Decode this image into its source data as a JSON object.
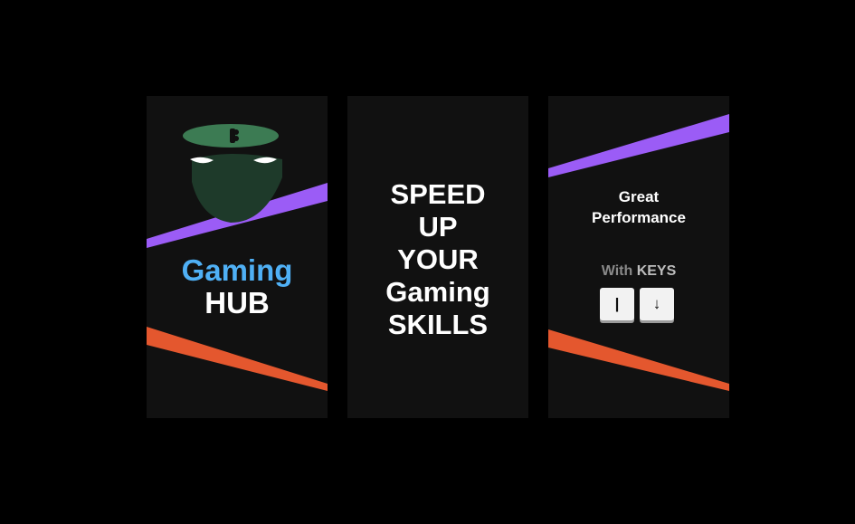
{
  "colors": {
    "background": "#000000",
    "card": "#111111",
    "purple": "#9b5cf6",
    "orange": "#e4572e",
    "blue": "#4fb0f5",
    "white": "#ffffff",
    "mask_green": "#3c7b53",
    "gray_text": "#8a8a8a"
  },
  "card1": {
    "icon": "ninja-mask-icon",
    "title_word1": "Gaming",
    "title_word2": "HUB"
  },
  "card2": {
    "lines": [
      "SPEED",
      "UP",
      "YOUR",
      "Gaming",
      "SKILLS"
    ]
  },
  "card3": {
    "heading_line1": "Great",
    "heading_line2": "Performance",
    "keys_prefix": "With ",
    "keys_word": "KEYS",
    "key1_label": "|",
    "key2_label": "↓"
  }
}
